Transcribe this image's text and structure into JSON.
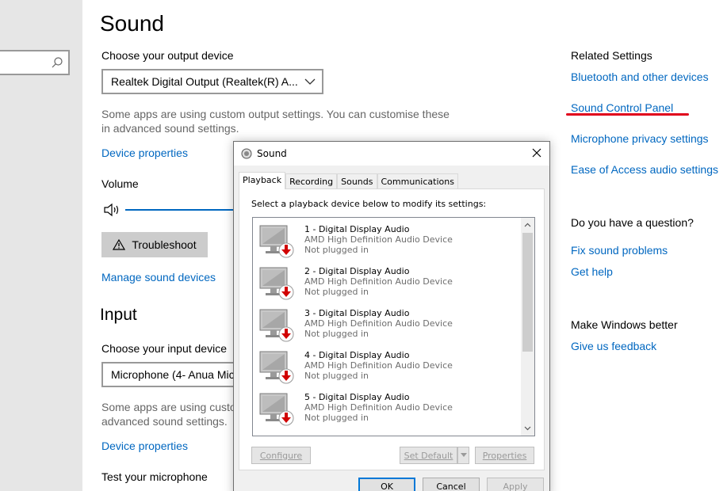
{
  "main": {
    "title": "Sound",
    "output": {
      "label": "Choose your output device",
      "selected": "Realtek Digital Output (Realtek(R) A...",
      "description": "Some apps are using custom output settings. You can customise these in advanced sound settings.",
      "device_properties": "Device properties"
    },
    "volume": {
      "label": "Volume"
    },
    "troubleshoot": "Troubleshoot",
    "manage_devices": "Manage sound devices",
    "input": {
      "title": "Input",
      "label": "Choose your input device",
      "selected": "Microphone (4- Anua Mic",
      "description": "Some apps are using custo\nadvanced sound settings.",
      "device_properties": "Device properties",
      "test_label": "Test your microphone"
    }
  },
  "related": {
    "heading": "Related Settings",
    "links": [
      "Bluetooth and other devices",
      "Sound Control Panel",
      "Microphone privacy settings",
      "Ease of Access audio settings"
    ],
    "question_heading": "Do you have a question?",
    "question_links": [
      "Fix sound problems",
      "Get help"
    ],
    "better_heading": "Make Windows better",
    "feedback": "Give us feedback"
  },
  "dialog": {
    "title": "Sound",
    "tabs": [
      "Playback",
      "Recording",
      "Sounds",
      "Communications"
    ],
    "instruction": "Select a playback device below to modify its settings:",
    "devices": [
      {
        "name": "1 - Digital Display Audio",
        "driver": "AMD High Definition Audio Device",
        "status": "Not plugged in"
      },
      {
        "name": "2 - Digital Display Audio",
        "driver": "AMD High Definition Audio Device",
        "status": "Not plugged in"
      },
      {
        "name": "3 - Digital Display Audio",
        "driver": "AMD High Definition Audio Device",
        "status": "Not plugged in"
      },
      {
        "name": "4 - Digital Display Audio",
        "driver": "AMD High Definition Audio Device",
        "status": "Not plugged in"
      },
      {
        "name": "5 - Digital Display Audio",
        "driver": "AMD High Definition Audio Device",
        "status": "Not plugged in"
      }
    ],
    "buttons": {
      "configure": "Configure",
      "set_default": "Set Default",
      "properties": "Properties",
      "ok": "OK",
      "cancel": "Cancel",
      "apply": "Apply"
    }
  },
  "colors": {
    "link": "#0067c0",
    "annotation": "#e0001b"
  }
}
